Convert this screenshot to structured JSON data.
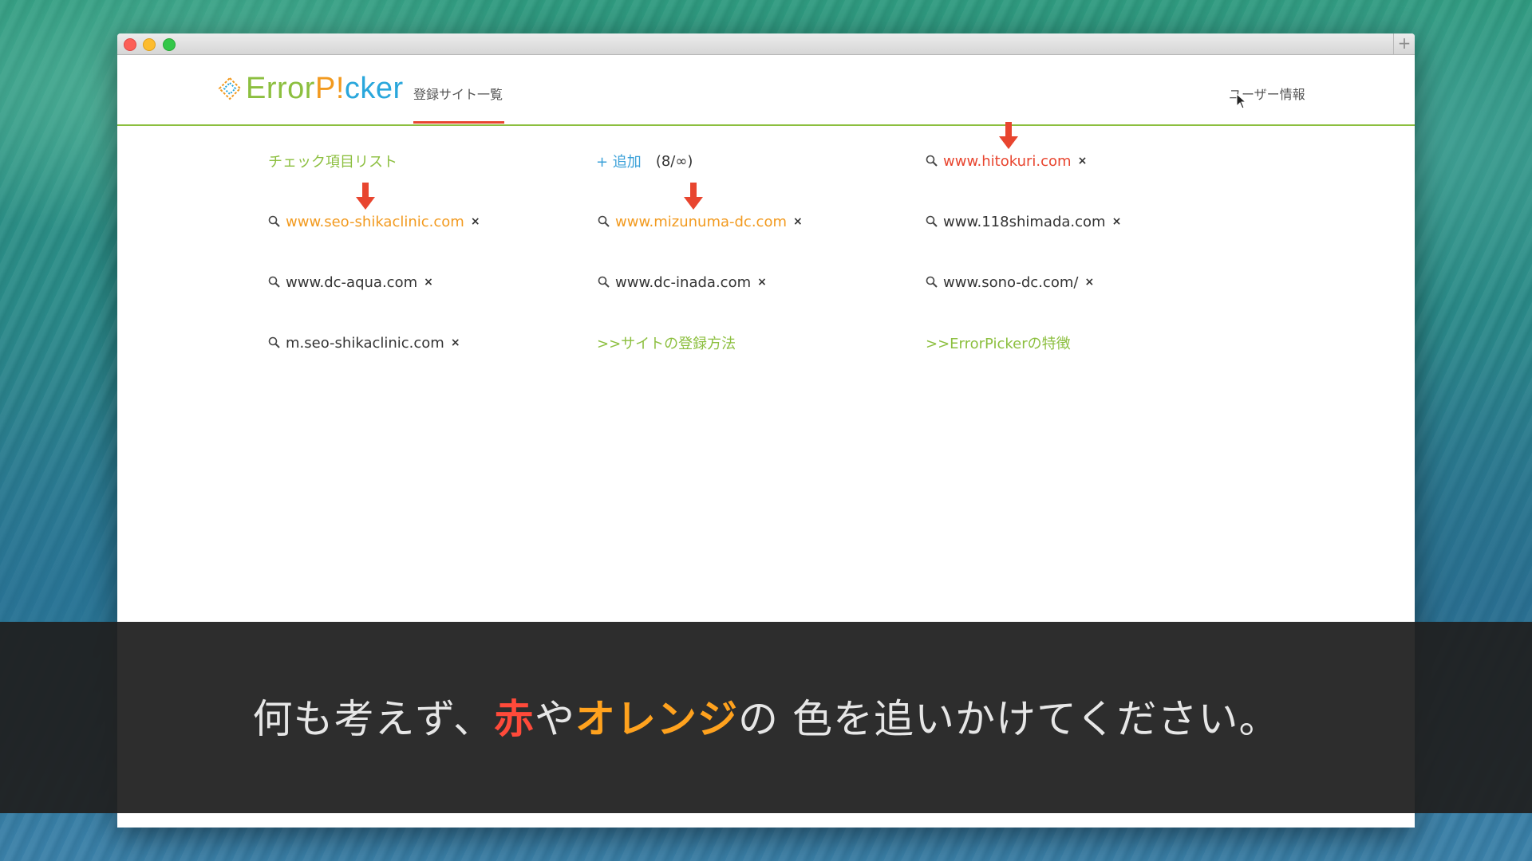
{
  "app": {
    "logo_text_part1": "Error",
    "logo_text_part2": "P",
    "logo_text_part3": "!",
    "logo_text_part4": "cker",
    "nav_sites": "登録サイト一覧",
    "nav_user": "ユーザー情報"
  },
  "content": {
    "checklist_link": "チェック項目リスト",
    "add_label": "+ 追加",
    "count_label": "(8/∞)",
    "sites": [
      {
        "label": "www.hitokuri.com",
        "status": "red"
      },
      {
        "label": "www.seo-shikaclinic.com",
        "status": "orange"
      },
      {
        "label": "www.mizunuma-dc.com",
        "status": "orange"
      },
      {
        "label": "www.118shimada.com",
        "status": "normal"
      },
      {
        "label": "www.dc-aqua.com",
        "status": "normal"
      },
      {
        "label": "www.dc-inada.com",
        "status": "normal"
      },
      {
        "label": "www.sono-dc.com/",
        "status": "normal"
      },
      {
        "label": "m.seo-shikaclinic.com",
        "status": "normal"
      }
    ],
    "remove_symbol": "×",
    "help_register": ">>サイトの登録方法",
    "help_features": ">>ErrorPickerの特徴"
  },
  "caption": {
    "part1": "何も考えず、",
    "part2": "赤",
    "part3": "や",
    "part4": "オレンジ",
    "part5": "の 色を追いかけてください。"
  },
  "colors": {
    "accent_green": "#8cbf3f",
    "status_red": "#e8452f",
    "status_orange": "#f29a1f",
    "link_blue": "#3aa0d8"
  }
}
